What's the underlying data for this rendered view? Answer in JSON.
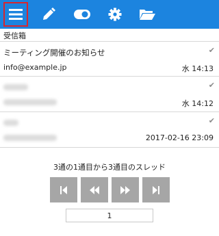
{
  "toolbar": {
    "buttons": [
      {
        "icon": "menu-icon"
      },
      {
        "icon": "pencil-icon"
      },
      {
        "icon": "toggle-icon"
      },
      {
        "icon": "gear-icon"
      },
      {
        "icon": "folder-icon"
      }
    ],
    "background": "#1c84df",
    "active_border": "#d8262e"
  },
  "folder": {
    "name": "受信箱"
  },
  "messages": [
    {
      "subject": "ミーティング開催のお知らせ",
      "from": "info@example.jp",
      "date": "水 14:13",
      "read": true
    },
    {
      "subject": "",
      "from": "",
      "date": "水 14:12",
      "read": true
    },
    {
      "subject": "",
      "from": "",
      "date": "2017-02-16 23:09",
      "read": true
    }
  ],
  "thread_info": "3通の1通目から3通目のスレッド",
  "pager": {
    "buttons": [
      "first-page",
      "previous-page",
      "next-page",
      "last-page"
    ],
    "page": "1"
  }
}
